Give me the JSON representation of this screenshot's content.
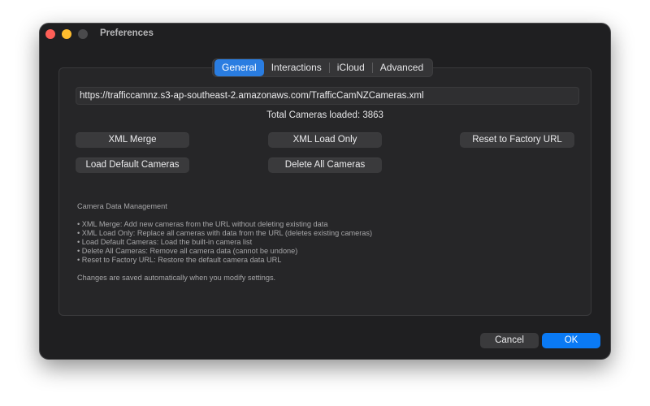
{
  "window": {
    "title": "Preferences"
  },
  "tabs": [
    {
      "label": "General",
      "active": true
    },
    {
      "label": "Interactions",
      "active": false
    },
    {
      "label": "iCloud",
      "active": false
    },
    {
      "label": "Advanced",
      "active": false
    }
  ],
  "general": {
    "url": "https://trafficcamnz.s3-ap-southeast-2.amazonaws.com/TrafficCamNZCameras.xml",
    "total_cameras": "Total Cameras loaded: 3863",
    "buttons": {
      "xml_merge": "XML Merge",
      "xml_load_only": "XML Load Only",
      "reset_factory_url": "Reset to Factory URL",
      "load_default": "Load Default Cameras",
      "delete_all": "Delete All Cameras"
    },
    "description": {
      "heading": "Camera Data Management",
      "items": [
        "• XML Merge: Add new cameras from the URL without deleting existing data",
        "• XML Load Only: Replace all cameras with data from the URL (deletes existing cameras)",
        "• Load Default Cameras: Load the built-in camera list",
        "• Delete All Cameras: Remove all camera data (cannot be undone)",
        "• Reset to Factory URL: Restore the default camera data URL"
      ],
      "footer": "Changes are saved automatically when you modify settings."
    }
  },
  "footer": {
    "cancel_label": "Cancel",
    "ok_label": "OK"
  },
  "colors": {
    "accent": "#0a7af5",
    "tab_active": "#2a7de1",
    "window_bg": "#1f1f21",
    "panel_bg": "#262628"
  }
}
